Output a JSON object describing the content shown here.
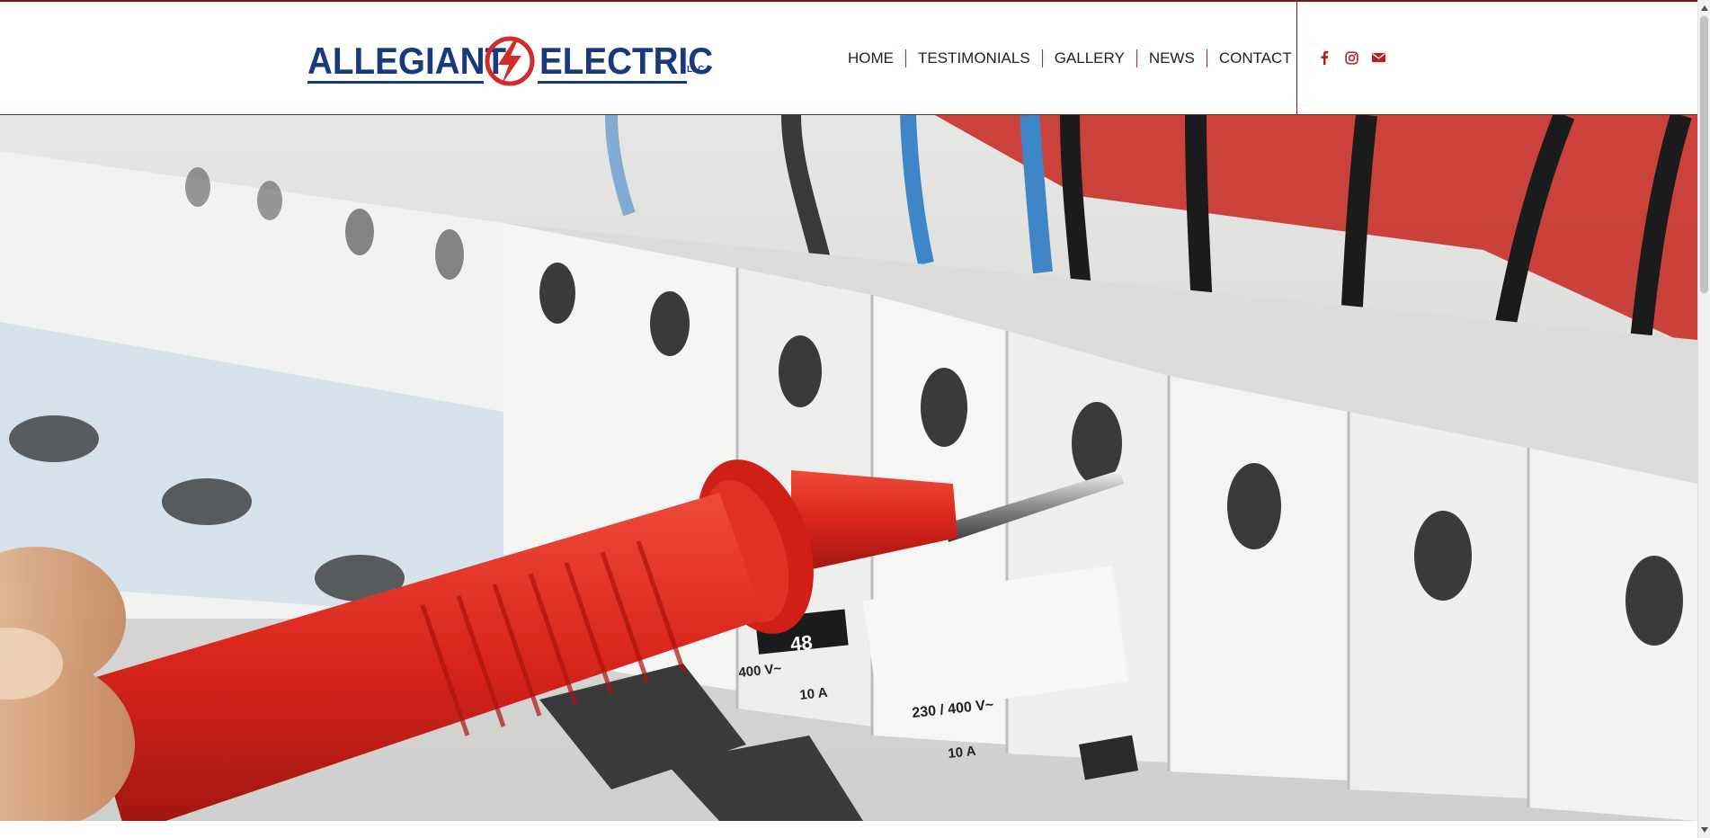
{
  "header": {
    "logo": {
      "word_left": "ALLEGIANT",
      "word_right": "ELECTRIC",
      "suffix": "LLC",
      "colors": {
        "primary": "#17397f",
        "accent": "#d22b2b"
      }
    },
    "nav": [
      {
        "label": "HOME"
      },
      {
        "label": "TESTIMONIALS"
      },
      {
        "label": "GALLERY"
      },
      {
        "label": "NEWS"
      },
      {
        "label": "CONTACT"
      }
    ],
    "nav_separator_color": "#b22222",
    "social": [
      {
        "icon": "facebook-icon"
      },
      {
        "icon": "instagram-icon"
      },
      {
        "icon": "mail-icon"
      }
    ],
    "border_color": "#7a1a1a",
    "social_color": "#b22222"
  },
  "hero": {
    "image": "electrician-testing-circuit-breakers-with-red-probe",
    "colors": {
      "probe": "#d8241c",
      "breaker": "#efefed",
      "wire_black": "#1b1b1b",
      "wire_blue": "#3f86c8"
    },
    "breaker_labels": [
      "48",
      "400 V~",
      "10 A",
      "230 / 400 V~",
      "10 A"
    ]
  }
}
